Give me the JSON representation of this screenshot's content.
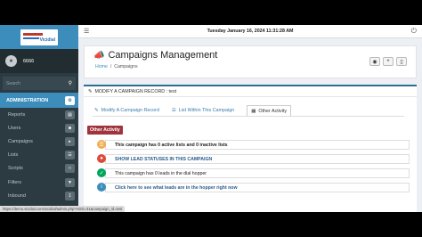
{
  "header": {
    "datetime": "Tuesday January 16, 2024 11:31:28 AM"
  },
  "sidebar": {
    "logo_text": "Vicidial",
    "user_name": "6666",
    "search_placeholder": "Search",
    "section_label": "ADMINISTRATION",
    "items": [
      {
        "label": "Reports",
        "icon": "bar-chart-icon"
      },
      {
        "label": "Users",
        "icon": "user-icon"
      },
      {
        "label": "Campaigns",
        "icon": "bullhorn-icon"
      },
      {
        "label": "Lists",
        "icon": "list-icon"
      },
      {
        "label": "Scripts",
        "icon": "file-icon"
      },
      {
        "label": "Filters",
        "icon": "filter-icon"
      },
      {
        "label": "Inbound",
        "icon": "inbox-icon"
      }
    ]
  },
  "page": {
    "title": "Campaigns Management",
    "breadcrumb": [
      "Home",
      "Campaigns"
    ]
  },
  "box": {
    "header": "MODIFY A CAMPAIGN RECORD : test",
    "tabs": [
      {
        "label": "Modify A Campaign Record",
        "active": false
      },
      {
        "label": "List Within This Campaign",
        "active": false
      },
      {
        "label": "Other Activity",
        "active": true
      }
    ],
    "badge": "Other Activity",
    "activities": [
      {
        "text": "This campaign has 0 active lists and 0 inactive lists",
        "color": "#f0ad4e",
        "style": "bold"
      },
      {
        "text": "SHOW LEAD STATUSES IN THIS CAMPAIGN",
        "color": "#dd4b39",
        "style": "bold-link"
      },
      {
        "text": "This campaign has 0 leads in the dial hopper",
        "color": "#00a65a",
        "style": "normal"
      },
      {
        "text": "Click here to see what leads are in the hopper right now",
        "color": "#3c8dbc",
        "style": "bold-link"
      }
    ]
  },
  "status_url": "https://demo.vicidial.com/vicidial/admin.php?ADD=31&campaign_id=test"
}
